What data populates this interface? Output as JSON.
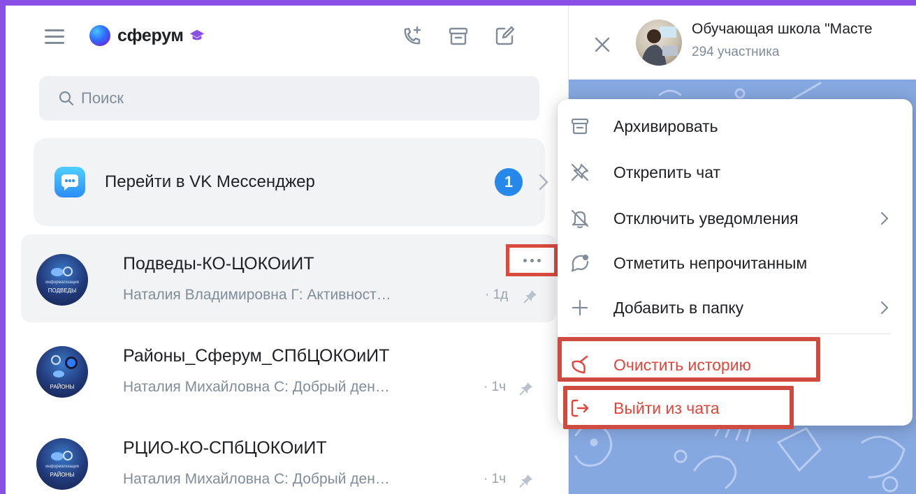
{
  "app": {
    "brand": "сферум"
  },
  "search": {
    "placeholder": "Поиск"
  },
  "vk_card": {
    "label": "Перейти в VK Мессенджер",
    "badge": "1"
  },
  "chats": [
    {
      "title": "Подведы-КО-ЦОКОиИТ",
      "preview": "Наталия Владимировна Г: Активност…",
      "time": "· 1д",
      "avatar_text": [
        "информатизация",
        "ПОДВЕДЫ"
      ],
      "pinned": true,
      "selected": true
    },
    {
      "title": "Районы_Сферум_СПбЦОКОиИТ",
      "preview": "Наталия Михайловна С: Добрый ден…",
      "time": "· 1ч",
      "avatar_text": [
        "РАЙОНЫ"
      ],
      "pinned": true,
      "selected": false
    },
    {
      "title": "РЦИО-КО-СПбЦОКОиИТ",
      "preview": "Наталия Михайловна С: Добрый ден…",
      "time": "· 1ч",
      "avatar_text": [
        "информатизация",
        "РАЙОНЫ"
      ],
      "pinned": true,
      "selected": false
    }
  ],
  "open_chat": {
    "title": "Обучающая школа \"Масте",
    "subtitle": "294 участника"
  },
  "context_menu": {
    "items": [
      {
        "label": "Архивировать",
        "icon": "archive-icon",
        "submenu": false
      },
      {
        "label": "Открепить чат",
        "icon": "unpin-icon",
        "submenu": false
      },
      {
        "label": "Отключить уведомления",
        "icon": "bell-off-icon",
        "submenu": true
      },
      {
        "label": "Отметить непрочитанным",
        "icon": "unread-icon",
        "submenu": false
      },
      {
        "label": "Добавить в папку",
        "icon": "plus-icon",
        "submenu": true
      },
      {
        "label": "Очистить историю",
        "icon": "broom-icon",
        "submenu": false
      },
      {
        "label": "Выйти из чата",
        "icon": "exit-icon",
        "submenu": false
      }
    ]
  },
  "colors": {
    "accent": "#2688eb",
    "danger": "#e0463b",
    "highlight": "#cf4b3f",
    "frame": "#8a4fe6",
    "chat_background": "#86a8e0"
  }
}
